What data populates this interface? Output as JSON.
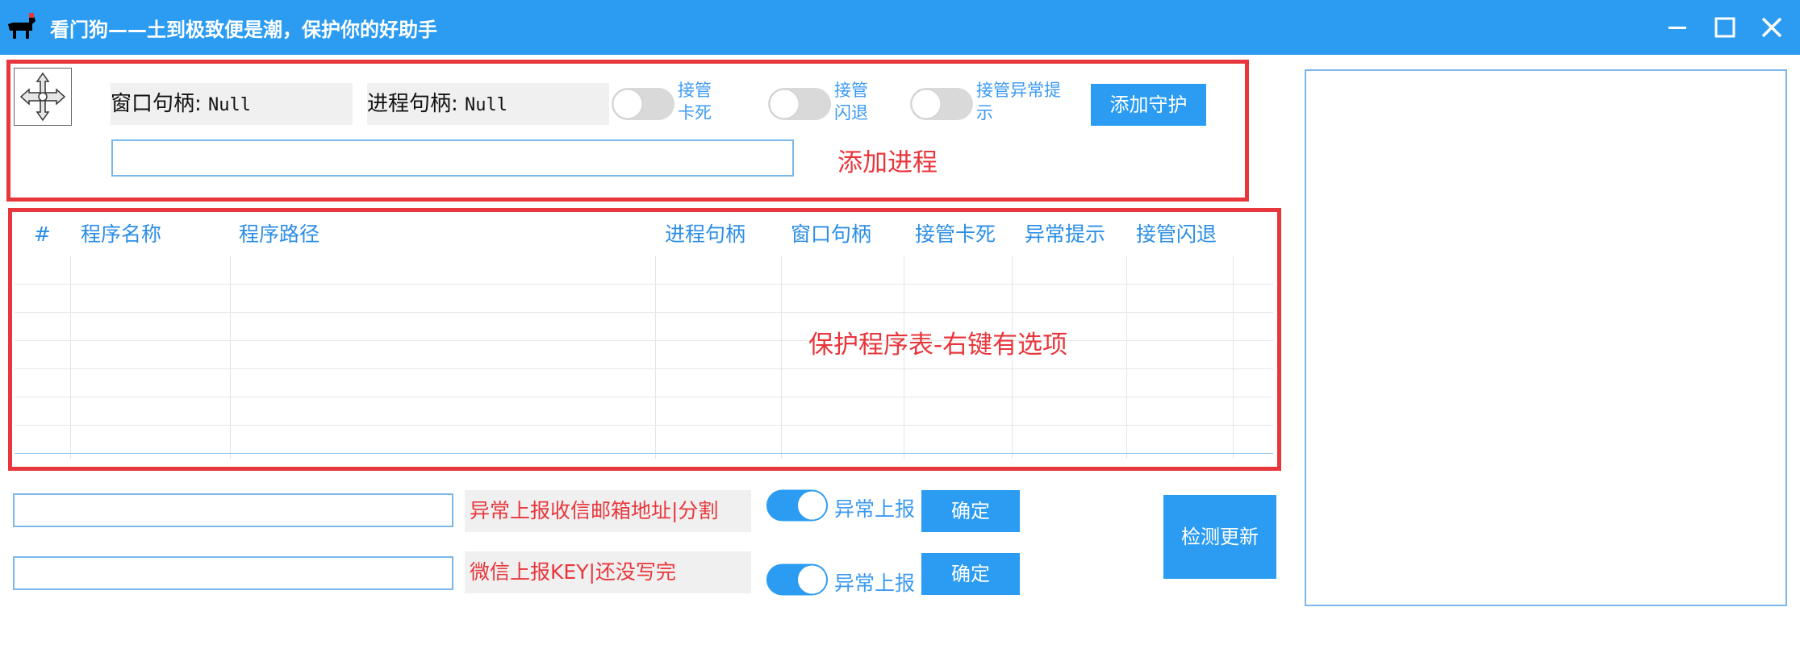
{
  "window": {
    "title": "看门狗——土到极致便是潮，保护你的好助手",
    "icon": "dog-icon",
    "controls": [
      "minimize-icon",
      "maximize-icon",
      "close-icon"
    ],
    "accent": "#2b9cf2"
  },
  "top": {
    "window_handle_label": "窗口句柄:",
    "window_handle_value": "Null",
    "process_handle_label": "进程句柄:",
    "process_handle_value": "Null",
    "toggles": [
      {
        "label": "接管卡死",
        "on": false
      },
      {
        "label": "接管闪退",
        "on": false
      },
      {
        "label": "接管异常提示",
        "on": false
      }
    ],
    "add_guard_button": "添加守护",
    "process_input_value": "",
    "add_process_note": "添加进程"
  },
  "table": {
    "columns": [
      "#",
      "程序名称",
      "程序路径",
      "进程句柄",
      "窗口句柄",
      "接管卡死",
      "异常提示",
      "接管闪退"
    ],
    "rows": [],
    "note": "保护程序表-右键有选项"
  },
  "report": {
    "email_input_value": "",
    "email_note": "异常上报收信邮箱地址|分割",
    "email_toggle_label": "异常上报",
    "email_toggle_on": true,
    "email_ok": "确定",
    "wechat_input_value": "",
    "wechat_note": "微信上报KEY|还没写完",
    "wechat_toggle_label": "异常上报",
    "wechat_toggle_on": true,
    "wechat_ok": "确定"
  },
  "check_update_button": "检测更新",
  "colors": {
    "red": "#e8373c",
    "blue": "#2b9cf2",
    "border_blue": "#7cb7ea"
  }
}
